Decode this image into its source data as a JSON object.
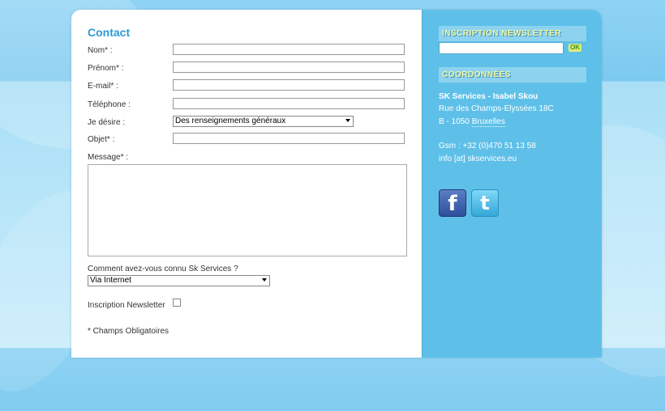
{
  "contact": {
    "title": "Contact",
    "fields": {
      "nom": "Nom* :",
      "prenom": "Prénom* :",
      "email": "E-mail* :",
      "telephone": "Téléphone :",
      "desire": "Je désire :",
      "objet": "Objet* :",
      "message": "Message* :"
    },
    "desire_value": "Des renseignements généraux",
    "how_label": "Comment avez-vous connu Sk Services ?",
    "how_value": "Via Internet",
    "newsletter_label": "Inscription Newsletter",
    "required_note": "* Champs Obligatoires"
  },
  "sidebar": {
    "newsletter_head": "INSCRIPTION NEWSLETTER",
    "ok_label": "OK",
    "coord_head": "COORDONNÉES",
    "company": "SK Services - Isabel Skou",
    "street": "Rue des Champs-Elyssées 18C",
    "city_prefix": "B - 1050 ",
    "city": "Bruxelles",
    "gsm": "Gsm : +32 (0)470 51 13 58",
    "email": "info [at] skservices.eu",
    "facebook_glyph": "f",
    "twitter_glyph": "t"
  }
}
